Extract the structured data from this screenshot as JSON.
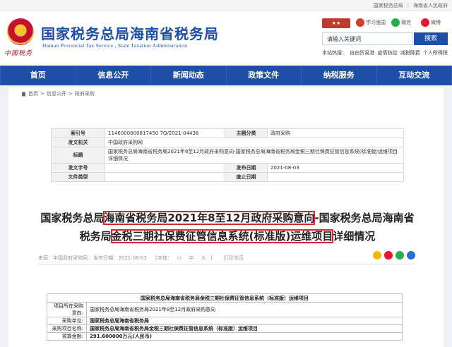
{
  "topbar": {
    "links": [
      "国家税务总局",
      "海南省人民政府"
    ]
  },
  "header": {
    "emblem_text": "中国税务",
    "title": "国家税务总局海南省税务局",
    "subtitle": "Hainan Provincial Tax Service , State Taxation Administration",
    "tools": [
      {
        "label": "学习强国",
        "icon": "xuexi-icon",
        "color": "#d43c2c"
      },
      {
        "label": "微信",
        "icon": "wechat-icon",
        "color": "#22b14c"
      },
      {
        "label": "微博",
        "icon": "weibo-icon",
        "color": "#e6162d"
      }
    ],
    "search_placeholder": "请输入关键词",
    "search_button": "搜索",
    "hot_label": "本站热搜：",
    "hot_words": [
      "自由贸易港",
      "疫情防控",
      "减税降费",
      "个人所得税"
    ]
  },
  "nav": {
    "items": [
      "首页",
      "信息公开",
      "新闻动态",
      "政策文件",
      "纳税服务",
      "互动交流"
    ]
  },
  "breadcrumb": {
    "items": [
      "首页",
      "信息公开",
      "政府采购"
    ],
    "sep": ">"
  },
  "info_table": {
    "index_no_label": "索引号",
    "index_no": "1146000000817450 7Q/2021-04436",
    "subject_label": "主题分类",
    "subject": "政府采购",
    "issuer_label": "发文机关",
    "issuer": "中国政府采购网",
    "title_label": "标题",
    "title": "国家税务总局海南省税务局2021年8至12月政府采购意向-国家税务总局海南省税务局金税三期社保费征管信息系统(标准版)运维项目详细情况",
    "doc_no_label": "发文字号",
    "doc_no": "",
    "date_label": "发布日期",
    "date": "2021-08-03",
    "file_type_label": "文件类型",
    "file_type": "",
    "invalid_label": "废止日期",
    "invalid": ""
  },
  "article": {
    "title_part1": "国家税务总局",
    "title_part2": "海南省税务局2021年8至12月政府采购意向",
    "title_part3": "-国家税务总局海南省",
    "title_part4": "税务局",
    "title_part5": "金税三期社保费征管信息系统(标准版)运维项目",
    "title_part6": "详细情况",
    "source": "来源：中国政府采购网",
    "published": "发布日期：2021-08-03",
    "font_label": "[字体：",
    "font_small": "小",
    "font_mid": "中",
    "font_large": "大",
    "font_end": "]",
    "print": "打印本页",
    "share_icons": [
      {
        "icon": "qzone-icon",
        "color": "#f5b700"
      },
      {
        "icon": "weibo-share-icon",
        "color": "#e6162d"
      },
      {
        "icon": "wechat-share-icon",
        "color": "#22b14c"
      },
      {
        "icon": "more-share-icon",
        "color": "#2b6fd6"
      }
    ]
  },
  "plan_table": {
    "header": "国家税务总局海南省税务局金税三期社保费征管信息系统（标准版）运维项目",
    "rows": [
      {
        "label": "项目所在采购意向:",
        "value": "国家税务总局海南省税务局2021年8至12月政府采购意向"
      },
      {
        "label": "采购单位:",
        "value": "国家税务总局海南省税务局"
      },
      {
        "label": "采购项目名称:",
        "value": "国家税务总局海南省税务局金税三期社保费征管信息系统（标准版）运维项目"
      },
      {
        "label": "预算金额:",
        "value": "291.600000万元(人民币)"
      }
    ]
  }
}
